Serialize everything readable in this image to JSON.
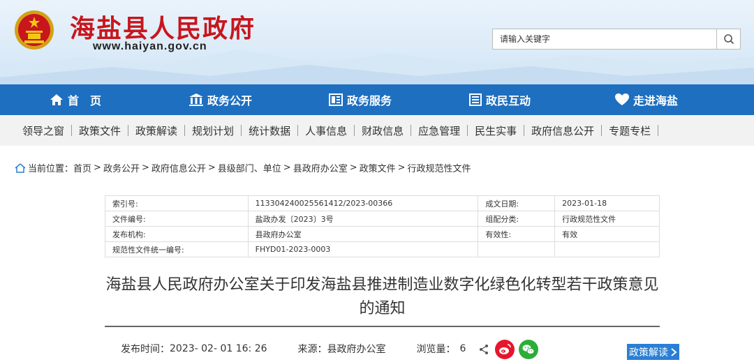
{
  "site": {
    "title": "海盐县人民政府",
    "url": "www.haiyan.gov.cn"
  },
  "search": {
    "placeholder": "请输入关键字"
  },
  "main_nav": [
    {
      "label": "首　页",
      "icon": "home-icon"
    },
    {
      "label": "政务公开",
      "icon": "building-icon"
    },
    {
      "label": "政务服务",
      "icon": "document-icon"
    },
    {
      "label": "政民互动",
      "icon": "list-icon"
    },
    {
      "label": "走进海盐",
      "icon": "heart-icon"
    }
  ],
  "sub_nav": [
    "领导之窗",
    "政策文件",
    "政策解读",
    "规划计划",
    "统计数据",
    "人事信息",
    "财政信息",
    "应急管理",
    "民生实事",
    "政府信息公开",
    "专题专栏"
  ],
  "breadcrumb": {
    "prefix": "当前位置：",
    "items": [
      "首页",
      "政务公开",
      "政府信息公开",
      "县级部门、单位",
      "县政府办公室",
      "政策文件",
      "行政规范性文件"
    ]
  },
  "meta": {
    "index_label": "索引号:",
    "index_value": "113304240025561412/2023-00366",
    "date_label": "成文日期:",
    "date_value": "2023-01-18",
    "docno_label": "文件编号:",
    "docno_value": "盐政办发〔2023〕3号",
    "group_label": "组配分类:",
    "group_value": "行政规范性文件",
    "org_label": "发布机构:",
    "org_value": "县政府办公室",
    "valid_label": "有效性:",
    "valid_value": "有效",
    "code_label": "规范性文件统一编号:",
    "code_value": "FHYD01-2023-0003"
  },
  "document": {
    "title_line1": "海盐县人民政府办公室关于印发海盐县推进制造业数字化绿色化转型若干政策意见",
    "title_line2": "的通知"
  },
  "info": {
    "time_label": "发布时间：",
    "time_value": "2023- 02- 01 16: 26",
    "source_label": "来源：",
    "source_value": "县政府办公室",
    "views_label": "浏览量：",
    "views_value": "6"
  },
  "policy_button": "政策解读",
  "colors": {
    "brand_red": "#c8161d",
    "nav_blue": "#1e6fc0",
    "button_blue": "#2a7fd4",
    "weibo_red": "#e6162d",
    "wechat_green": "#2bad38"
  }
}
